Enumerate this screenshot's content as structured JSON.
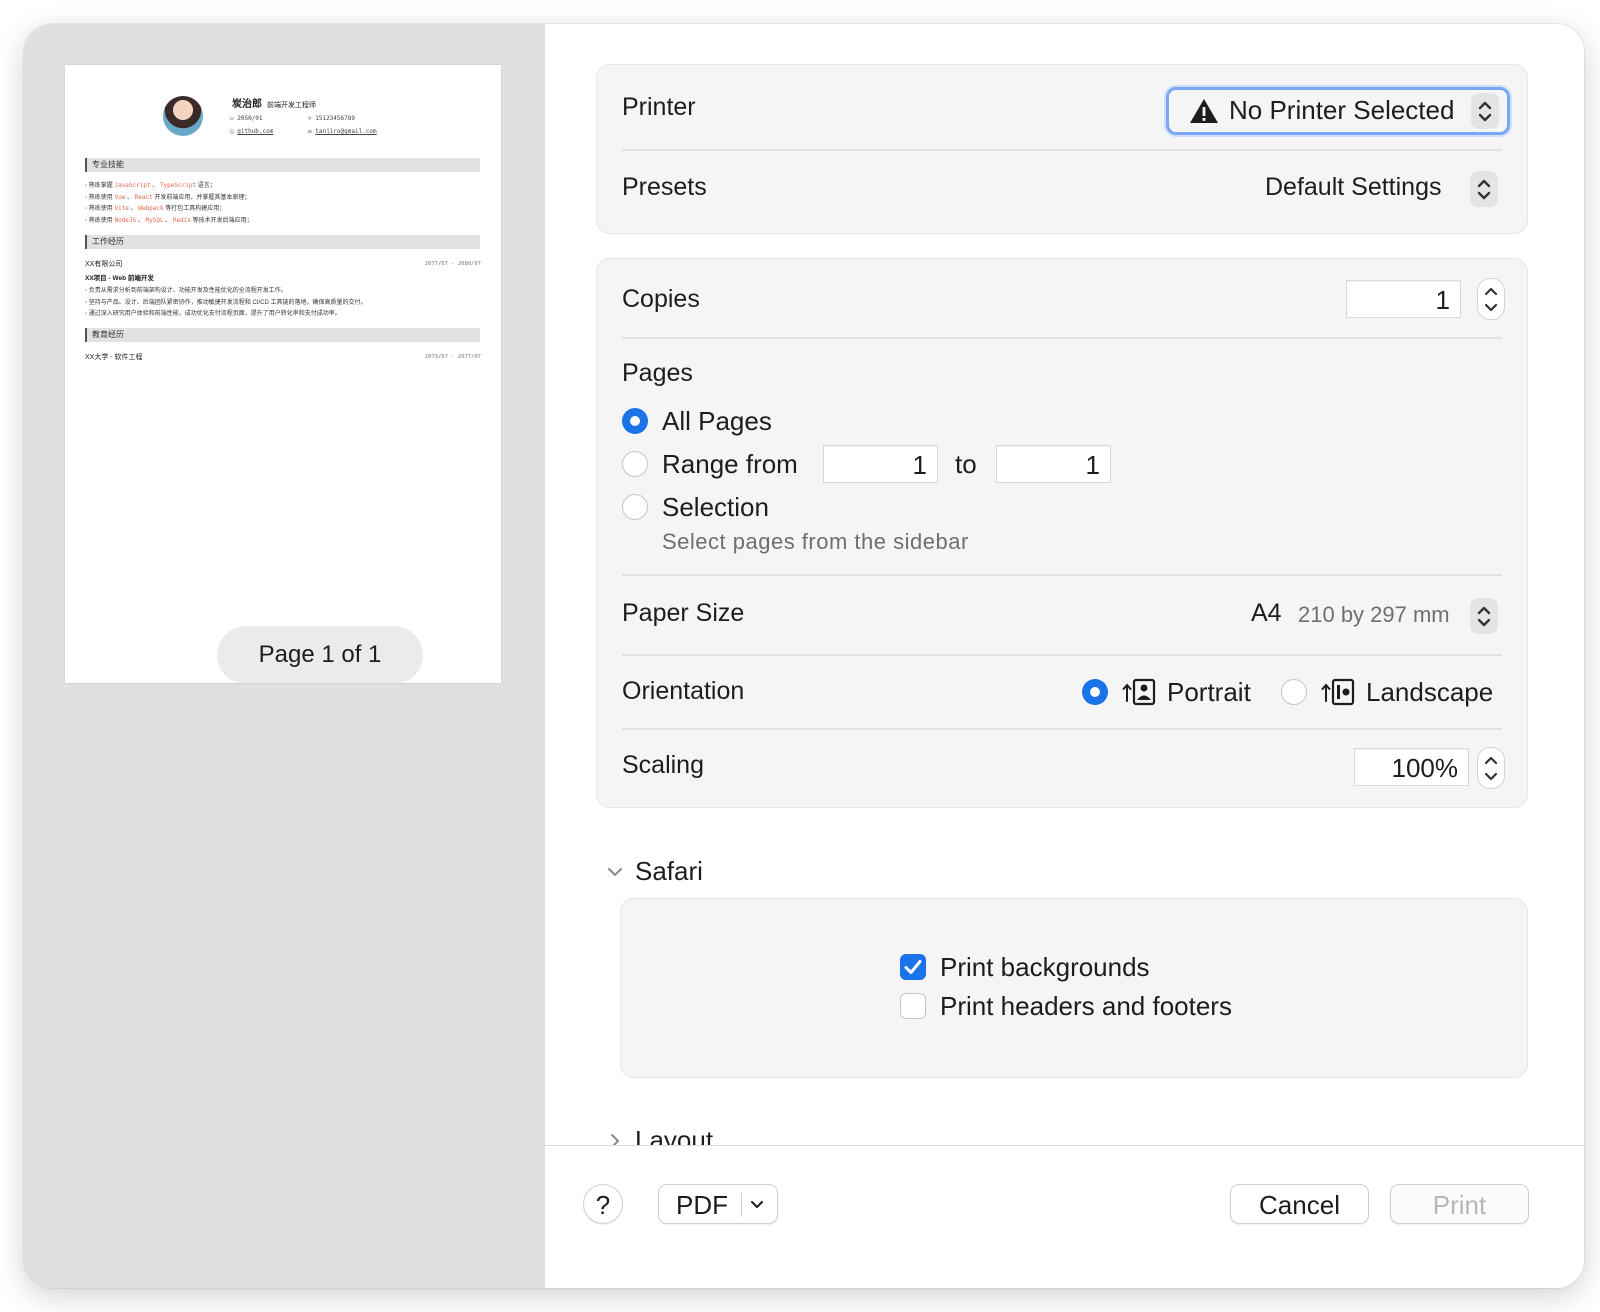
{
  "preview": {
    "page_indicator": "Page 1 of 1",
    "resume": {
      "name": "炭治郎",
      "role": "前端开发工程师",
      "birth": "2050/01",
      "phone": "15123456789",
      "github": "github.com",
      "email": "tanjiro@gmail.com",
      "sections": {
        "skills": "专业技能",
        "work": "工作经历",
        "education": "教育经历"
      },
      "skills": [
        {
          "prefix": "熟练掌握",
          "items": [
            "JavaScript",
            "TypeScript"
          ],
          "suffix": "语言；"
        },
        {
          "prefix": "熟练使用",
          "items": [
            "Vue",
            "React"
          ],
          "suffix": "开发前端应用，并掌握其基本原理；"
        },
        {
          "prefix": "熟练使用",
          "items": [
            "Vite",
            "Webpack"
          ],
          "suffix": "等打包工具构建应用；"
        },
        {
          "prefix": "熟练使用",
          "items": [
            "NodeJS",
            "MySQL",
            "Redis"
          ],
          "suffix": "等技术开发后端应用；"
        }
      ],
      "work": {
        "company": "XX有限公司",
        "period": "2077/07 - 2080/07",
        "project": "XX项目 - Web 前端开发",
        "bullets": [
          "负责从需求分析到前端架构设计、功能开发及性能优化的全流程开发工作。",
          "坚持与产品、设计、后端团队紧密协作，推动敏捷开发流程和 CI/CD 工具链的落地，确保高质量的交付。",
          "通过深入研究用户体验和前端性能，成功优化支付流程页面，提升了用户转化率和支付成功率。"
        ]
      },
      "education": {
        "school": "XX大学 - 软件工程",
        "period": "2073/07 - 2077/07"
      }
    }
  },
  "printer": {
    "label": "Printer",
    "value": "No Printer Selected",
    "warning_icon": "warning-triangle-icon"
  },
  "presets": {
    "label": "Presets",
    "value": "Default Settings"
  },
  "copies": {
    "label": "Copies",
    "value": "1"
  },
  "pages": {
    "label": "Pages",
    "all": "All Pages",
    "range_from": "Range from",
    "range_start": "1",
    "to": "to",
    "range_end": "1",
    "selection": "Selection",
    "selection_hint": "Select pages from the sidebar",
    "selected": "all"
  },
  "paper_size": {
    "label": "Paper Size",
    "value": "A4",
    "dimensions": "210 by 297 mm"
  },
  "orientation": {
    "label": "Orientation",
    "portrait": "Portrait",
    "landscape": "Landscape",
    "selected": "portrait"
  },
  "scaling": {
    "label": "Scaling",
    "value": "100%"
  },
  "safari": {
    "label": "Safari",
    "print_backgrounds": "Print backgrounds",
    "print_backgrounds_checked": true,
    "print_headers_footers": "Print headers and footers",
    "print_headers_footers_checked": false
  },
  "layout": {
    "label": "Layout"
  },
  "footer": {
    "help": "?",
    "pdf": "PDF",
    "cancel": "Cancel",
    "print": "Print"
  },
  "colors": {
    "accent": "#1a73e8",
    "highlight": "#e4664e",
    "focus_ring": "#7aa7f5"
  }
}
